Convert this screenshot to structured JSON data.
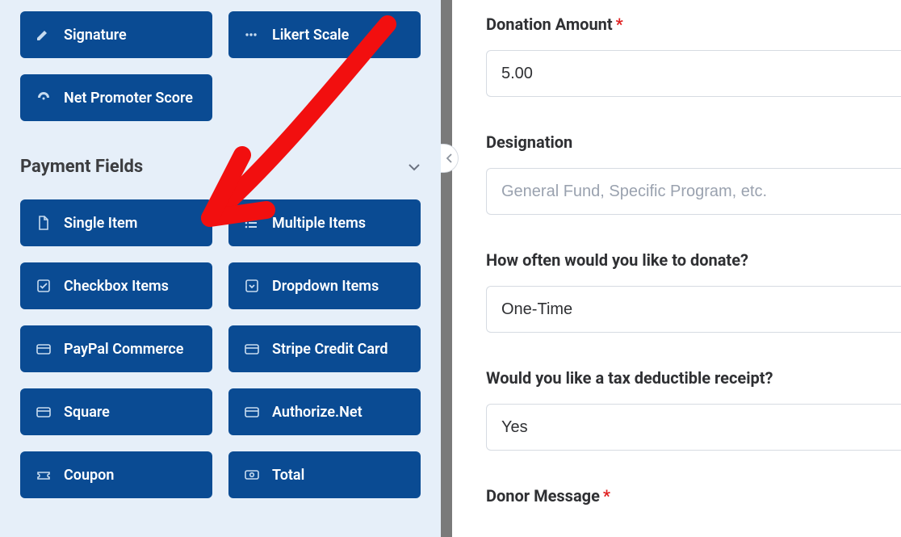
{
  "sidebar": {
    "top_fields": [
      {
        "icon": "pencil",
        "label": "Signature"
      },
      {
        "icon": "dots",
        "label": "Likert Scale"
      },
      {
        "icon": "gauge",
        "label": "Net Promoter Score"
      }
    ],
    "section_title": "Payment Fields",
    "payment_fields": [
      {
        "icon": "file",
        "label": "Single Item"
      },
      {
        "icon": "list",
        "label": "Multiple Items"
      },
      {
        "icon": "check-square",
        "label": "Checkbox Items"
      },
      {
        "icon": "caret-square",
        "label": "Dropdown Items"
      },
      {
        "icon": "card",
        "label": "PayPal Commerce"
      },
      {
        "icon": "card",
        "label": "Stripe Credit Card"
      },
      {
        "icon": "card",
        "label": "Square"
      },
      {
        "icon": "card",
        "label": "Authorize.Net"
      },
      {
        "icon": "ticket",
        "label": "Coupon"
      },
      {
        "icon": "money",
        "label": "Total"
      }
    ]
  },
  "form": {
    "fields": [
      {
        "label": "Donation Amount",
        "required": true,
        "value": "5.00",
        "placeholder": ""
      },
      {
        "label": "Designation",
        "required": false,
        "value": "",
        "placeholder": "General Fund, Specific Program, etc."
      },
      {
        "label": "How often would you like to donate?",
        "required": false,
        "value": "One-Time",
        "placeholder": ""
      },
      {
        "label": "Would you like a tax deductible receipt?",
        "required": false,
        "value": "Yes",
        "placeholder": ""
      },
      {
        "label": "Donor Message",
        "required": true,
        "value": "",
        "placeholder": "",
        "input": false
      }
    ]
  }
}
